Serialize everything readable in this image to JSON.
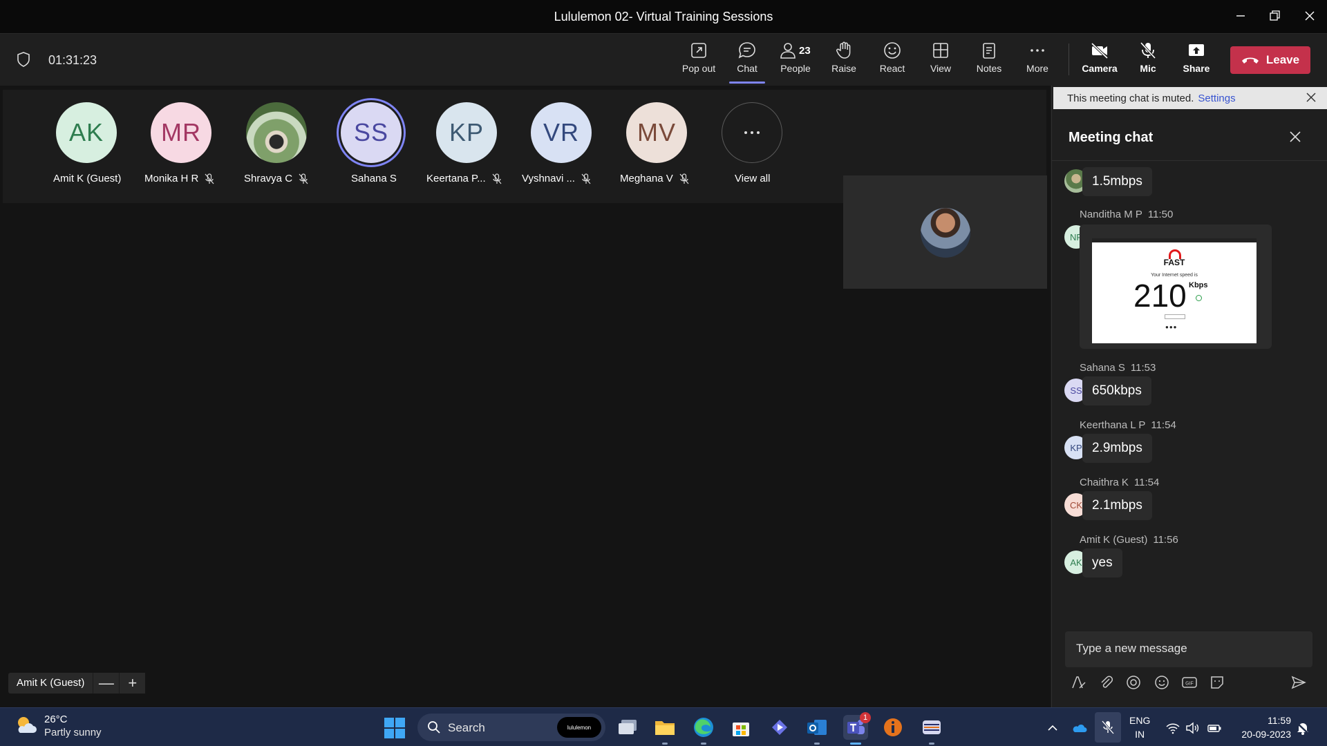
{
  "window": {
    "title": "Lululemon 02- Virtual Training Sessions"
  },
  "meeting": {
    "timer": "01:31:23",
    "people_count": "23",
    "toolbar": {
      "popout": "Pop out",
      "chat": "Chat",
      "people": "People",
      "raise": "Raise",
      "react": "React",
      "view": "View",
      "notes": "Notes",
      "more": "More",
      "camera": "Camera",
      "mic": "Mic",
      "share": "Share",
      "leave": "Leave"
    },
    "participants": [
      {
        "initials": "AK",
        "name": "Amit K (Guest)",
        "muted": false,
        "bg": "#d7efe0",
        "fg": "#2e7d4f"
      },
      {
        "initials": "MR",
        "name": "Monika H R",
        "muted": true,
        "bg": "#f7d9e3",
        "fg": "#a33763"
      },
      {
        "initials": "",
        "name": "Shravya C",
        "muted": true,
        "bg": "#6b8a5a",
        "fg": "#fff"
      },
      {
        "initials": "SS",
        "name": "Sahana S",
        "muted": false,
        "bg": "#dad9f3",
        "fg": "#4a48a0"
      },
      {
        "initials": "KP",
        "name": "Keertana P...",
        "muted": true,
        "bg": "#d9e5ee",
        "fg": "#3e5a73"
      },
      {
        "initials": "VR",
        "name": "Vyshnavi ...",
        "muted": true,
        "bg": "#d8e1f4",
        "fg": "#33487d"
      },
      {
        "initials": "MV",
        "name": "Meghana V",
        "muted": true,
        "bg": "#ede0d9",
        "fg": "#7a4a3a"
      }
    ],
    "view_all": "View all",
    "speaker_label": "Amit K (Guest)",
    "zoom_out": "—",
    "zoom_in": "+"
  },
  "chat": {
    "banner_text": "This meeting chat is muted.",
    "banner_link": "Settings",
    "title": "Meeting chat",
    "messages": [
      {
        "author": "",
        "time": "",
        "initials": "",
        "text": "1.5mbps"
      },
      {
        "author": "Nanditha M P",
        "time": "11:50",
        "initials": "NP",
        "text": ""
      },
      {
        "author": "Sahana S",
        "time": "11:53",
        "initials": "SS",
        "text": "650kbps"
      },
      {
        "author": "Keerthana L P",
        "time": "11:54",
        "initials": "KP",
        "text": "2.9mbps"
      },
      {
        "author": "Chaithra K",
        "time": "11:54",
        "initials": "CK",
        "text": "2.1mbps"
      },
      {
        "author": "Amit K (Guest)",
        "time": "11:56",
        "initials": "AK",
        "text": "yes"
      }
    ],
    "image": {
      "logo": "FAST",
      "subtitle": "Your Internet speed is",
      "speed": "210",
      "unit": "Kbps"
    },
    "compose_placeholder": "Type a new message"
  },
  "taskbar": {
    "temperature": "26°C",
    "weather": "Partly sunny",
    "search_label": "Search",
    "search_pill": "lululemon",
    "teams_badge": "1",
    "lang_top": "ENG",
    "lang_bottom": "IN",
    "time": "11:59",
    "date": "20-09-2023"
  },
  "colors": {
    "leave": "#c4314b",
    "accent": "#7f85f5",
    "taskbar": "#1e2a47"
  }
}
